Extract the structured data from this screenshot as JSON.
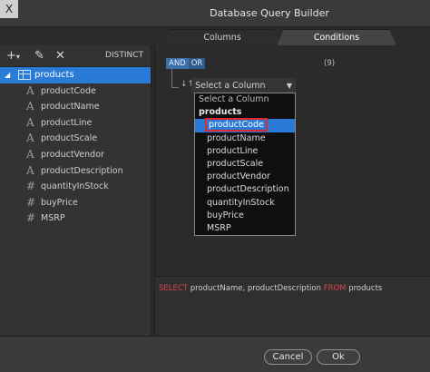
{
  "window": {
    "title": "Database Query Builder",
    "close_glyph": "X"
  },
  "left_toolbar": {
    "distinct_label": "DISTINCT"
  },
  "tree": {
    "table_name": "products",
    "fields": [
      {
        "name": "productCode",
        "type": "text"
      },
      {
        "name": "productName",
        "type": "text"
      },
      {
        "name": "productLine",
        "type": "text"
      },
      {
        "name": "productScale",
        "type": "text"
      },
      {
        "name": "productVendor",
        "type": "text"
      },
      {
        "name": "productDescription",
        "type": "text"
      },
      {
        "name": "quantityInStock",
        "type": "number"
      },
      {
        "name": "buyPrice",
        "type": "number"
      },
      {
        "name": "MSRP",
        "type": "number"
      }
    ]
  },
  "tabs": [
    {
      "label": "Columns",
      "active": false
    },
    {
      "label": "Conditions",
      "active": true
    }
  ],
  "conditions": {
    "and_label": "AND",
    "or_label": "OR",
    "count_label": "(9)",
    "column_select_placeholder": "Select a Column"
  },
  "dropdown": {
    "header": "Select a Column",
    "group": "products",
    "items": [
      "productCode",
      "productName",
      "productLine",
      "productScale",
      "productVendor",
      "productDescription",
      "quantityInStock",
      "buyPrice",
      "MSRP"
    ],
    "selected": "productCode"
  },
  "sql": {
    "kw_select": "SELECT",
    "columns": "productName, productDescription",
    "kw_from": "FROM",
    "table": "products"
  },
  "footer": {
    "cancel_label": "Cancel",
    "ok_label": "Ok"
  },
  "colors": {
    "accent": "#2a7bd8",
    "highlight_border": "#e0282e",
    "sql_keyword": "#e0424a"
  }
}
